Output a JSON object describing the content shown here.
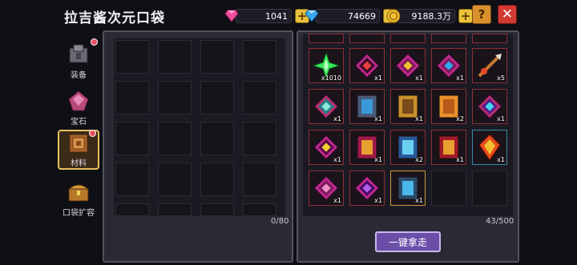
{
  "header": {
    "title": "拉吉酱次元口袋",
    "gems": "1041",
    "diamonds": "74669",
    "coins": "9188.3万",
    "help_label": "?",
    "close_label": "✕",
    "plus_label": "+"
  },
  "sidebar": {
    "items": [
      {
        "label": "装备",
        "badge": true
      },
      {
        "label": "宝石",
        "badge": false
      },
      {
        "label": "材料",
        "badge": true,
        "active": true
      },
      {
        "label": "口袋扩容",
        "badge": false
      }
    ]
  },
  "left_panel": {
    "capacity": "0/80"
  },
  "right_panel": {
    "capacity": "43/500",
    "take_all_label": "一键拿走",
    "items": [
      {
        "qty": "x1010",
        "icon": "green-crystal-icon",
        "rarity": "red"
      },
      {
        "qty": "x1",
        "icon": "red-tome-icon",
        "rarity": "red"
      },
      {
        "qty": "x1",
        "icon": "gold-crystal-icon",
        "rarity": "red"
      },
      {
        "qty": "x1",
        "icon": "blue-crystal-icon",
        "rarity": "red"
      },
      {
        "qty": "x5",
        "icon": "spear-icon",
        "rarity": "red"
      },
      {
        "qty": "x1",
        "icon": "cyan-crystal-icon",
        "rarity": "red"
      },
      {
        "qty": "x1",
        "icon": "blue-tablet-icon",
        "rarity": "red"
      },
      {
        "qty": "x1",
        "icon": "portrait-card-icon",
        "rarity": "red"
      },
      {
        "qty": "x2",
        "icon": "orange-card-icon",
        "rarity": "red"
      },
      {
        "qty": "x1",
        "icon": "cyan-gem-icon",
        "rarity": "red"
      },
      {
        "qty": "x1",
        "icon": "yellow-crystal-icon",
        "rarity": "red"
      },
      {
        "qty": "x1",
        "icon": "rune-tome-icon",
        "rarity": "red"
      },
      {
        "qty": "x2",
        "icon": "ice-tablet-icon",
        "rarity": "red"
      },
      {
        "qty": "x1",
        "icon": "red-scroll-icon",
        "rarity": "red"
      },
      {
        "qty": "x1",
        "icon": "fire-gem-icon",
        "rarity": "blue"
      },
      {
        "qty": "x1",
        "icon": "pink-crystal-icon",
        "rarity": "red"
      },
      {
        "qty": "x1",
        "icon": "purple-crystal-icon",
        "rarity": "red"
      },
      {
        "qty": "x1",
        "icon": "ice-block-icon",
        "rarity": "gold"
      },
      {
        "qty": "",
        "icon": "",
        "rarity": "empty"
      },
      {
        "qty": "",
        "icon": "",
        "rarity": "empty"
      }
    ]
  },
  "colors": {
    "accent": "#e8c23a",
    "close": "#d23a33",
    "button": "#6a4ea8"
  }
}
